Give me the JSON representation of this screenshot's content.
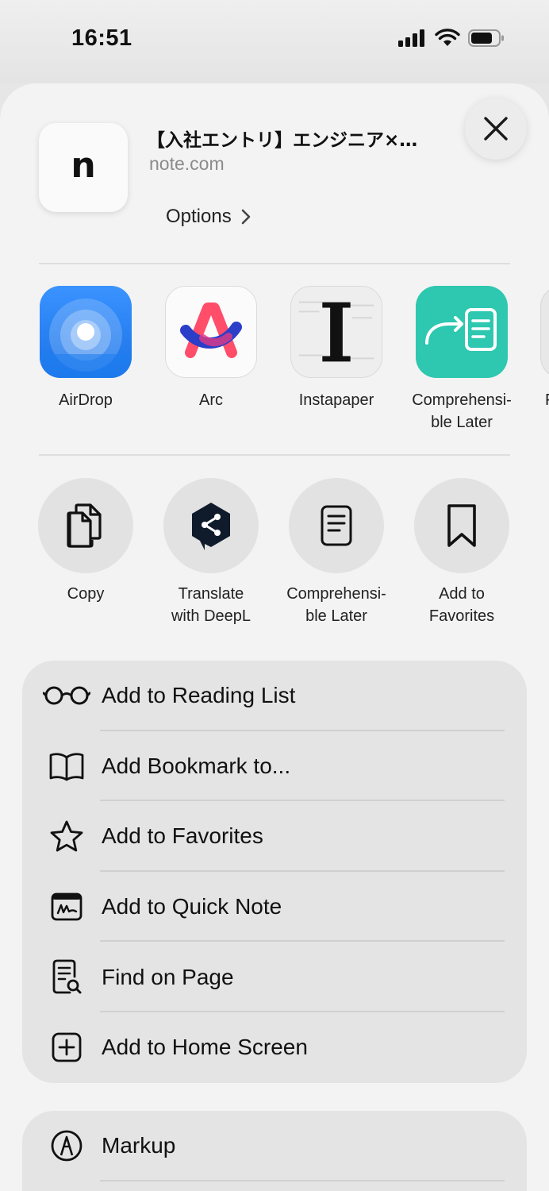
{
  "status": {
    "time": "16:51"
  },
  "header": {
    "thumb_letter": "n",
    "title": "【入社エントリ】エンジニア×…",
    "domain": "note.com",
    "options_label": "Options"
  },
  "apps": [
    {
      "label": "AirDrop",
      "icon": "airdrop-icon"
    },
    {
      "label": "Arc",
      "icon": "arc-icon"
    },
    {
      "label": "Instapaper",
      "icon": "instapaper-icon"
    },
    {
      "label": "Comprehensi-\nble Later",
      "icon": "comprehensible-later-icon"
    },
    {
      "label": "F"
    }
  ],
  "actions": [
    {
      "label": "Copy",
      "icon": "copy-icon"
    },
    {
      "label": "Translate\nwith DeepL",
      "icon": "deepl-icon"
    },
    {
      "label": "Comprehensi-\nble Later",
      "icon": "document-icon"
    },
    {
      "label": "Add to\nFavorites",
      "icon": "bookmark-icon"
    }
  ],
  "menu": [
    {
      "label": "Add to Reading List",
      "icon": "glasses-icon"
    },
    {
      "label": "Add Bookmark to...",
      "icon": "book-icon"
    },
    {
      "label": "Add to Favorites",
      "icon": "star-icon"
    },
    {
      "label": "Add to Quick Note",
      "icon": "quick-note-icon"
    },
    {
      "label": "Find on Page",
      "icon": "find-on-page-icon"
    },
    {
      "label": "Add to Home Screen",
      "icon": "add-square-icon"
    }
  ],
  "menu2": [
    {
      "label": "Markup",
      "icon": "markup-icon"
    }
  ],
  "colors": {
    "sheet_bg": "#f3f3f3",
    "group_bg": "#e4e4e4",
    "airdrop_blue": "#1f7ff0",
    "comprehensible_teal": "#2ec7b0"
  }
}
